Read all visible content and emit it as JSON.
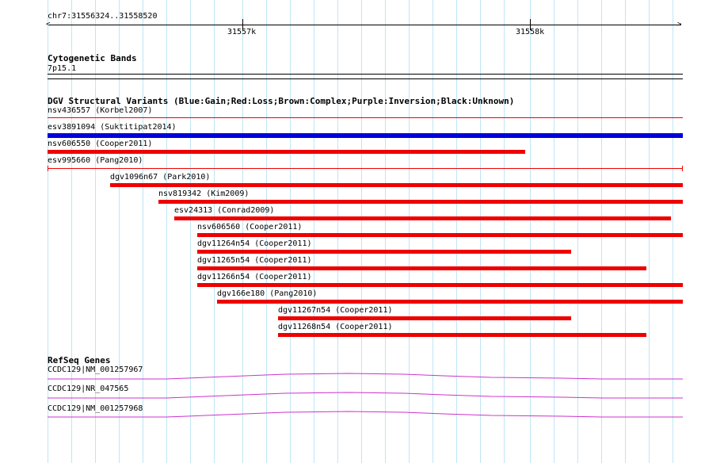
{
  "ruler": {
    "region": "chr7:31556324..31558520",
    "major_ticks": [
      "31557k",
      "31558k"
    ]
  },
  "cytoband": {
    "title": "Cytogenetic Bands",
    "band": "7p15.1"
  },
  "dgv": {
    "title": "DGV Structural Variants (Blue:Gain;Red:Loss;Brown:Complex;Purple:Inversion;Black:Unknown)",
    "colors": {
      "gain": "#0000dd",
      "loss": "#ee0000"
    },
    "features": [
      {
        "label": "nsv436557 (Korbel2007)",
        "type": "loss",
        "style": "line"
      },
      {
        "label": "esv3891094 (Suktitipat2014)",
        "type": "gain",
        "style": "bar"
      },
      {
        "label": "nsv606550 (Cooper2011)",
        "type": "loss",
        "style": "bar"
      },
      {
        "label": "esv995660 (Pang2010)",
        "type": "loss",
        "style": "line-ticks"
      },
      {
        "label": "dgv1096n67 (Park2010)",
        "type": "loss",
        "style": "bar"
      },
      {
        "label": "nsv819342 (Kim2009)",
        "type": "loss",
        "style": "bar"
      },
      {
        "label": "esv24313 (Conrad2009)",
        "type": "loss",
        "style": "bar"
      },
      {
        "label": "nsv606560 (Cooper2011)",
        "type": "loss",
        "style": "bar"
      },
      {
        "label": "dgv11264n54 (Cooper2011)",
        "type": "loss",
        "style": "bar"
      },
      {
        "label": "dgv11265n54 (Cooper2011)",
        "type": "loss",
        "style": "bar"
      },
      {
        "label": "dgv11266n54 (Cooper2011)",
        "type": "loss",
        "style": "bar"
      },
      {
        "label": "dgv166e180 (Pang2010)",
        "type": "loss",
        "style": "bar"
      },
      {
        "label": "dgv11267n54 (Cooper2011)",
        "type": "loss",
        "style": "bar"
      },
      {
        "label": "dgv11268n54 (Cooper2011)",
        "type": "loss",
        "style": "bar"
      }
    ]
  },
  "refseq": {
    "title": "RefSeq Genes",
    "color": "#cc33cc",
    "genes": [
      {
        "label": "CCDC129|NM_001257967"
      },
      {
        "label": "CCDC129|NR_047565"
      },
      {
        "label": "CCDC129|NM_001257968"
      }
    ]
  }
}
